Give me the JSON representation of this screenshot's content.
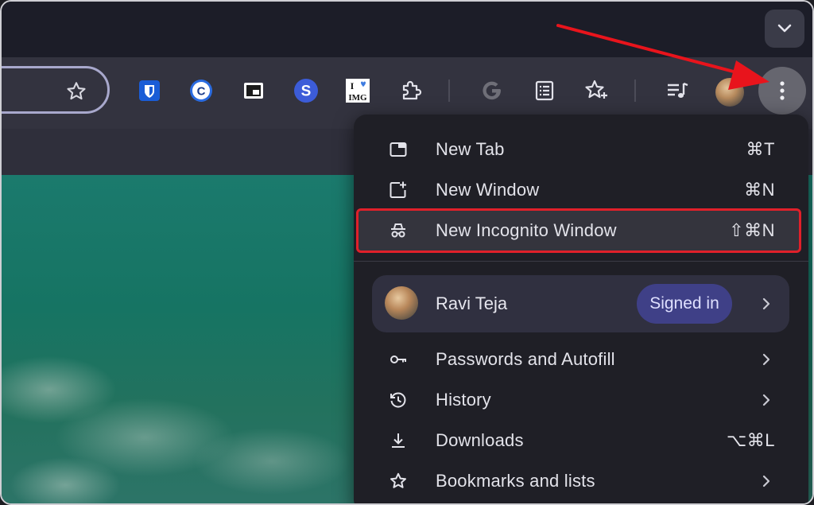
{
  "menu": {
    "items_top": [
      {
        "label": "New Tab",
        "shortcut": "⌘T",
        "icon": "new-tab-icon"
      },
      {
        "label": "New Window",
        "shortcut": "⌘N",
        "icon": "new-window-icon"
      },
      {
        "label": "New Incognito Window",
        "shortcut": "⇧⌘N",
        "icon": "incognito-icon",
        "highlighted": true
      }
    ],
    "profile": {
      "name": "Ravi Teja",
      "status": "Signed in"
    },
    "items_bottom": [
      {
        "label": "Passwords and Autofill",
        "icon": "key-icon",
        "submenu": true
      },
      {
        "label": "History",
        "icon": "history-icon",
        "submenu": true
      },
      {
        "label": "Downloads",
        "shortcut": "⌥⌘L",
        "icon": "download-icon"
      },
      {
        "label": "Bookmarks and lists",
        "icon": "bookmark-star-icon",
        "submenu": true
      }
    ]
  },
  "toolbar": {
    "extensions": [
      "bitwarden-icon",
      "c-extension-icon",
      "picture-in-picture-icon",
      "s-extension-icon",
      "i-love-img-icon",
      "extensions-puzzle-icon",
      "google-g-icon",
      "reading-list-icon",
      "bookmarks-star-icon",
      "media-controls-icon"
    ],
    "ext_text": {
      "s": "S",
      "iimg_top": "I",
      "iimg_bottom": "IMG",
      "c": "C"
    }
  },
  "colors": {
    "highlight_border": "#e0202a",
    "arrow": "#e8141c",
    "badge": "#3f4087",
    "menu_bg": "#1f1f26"
  }
}
